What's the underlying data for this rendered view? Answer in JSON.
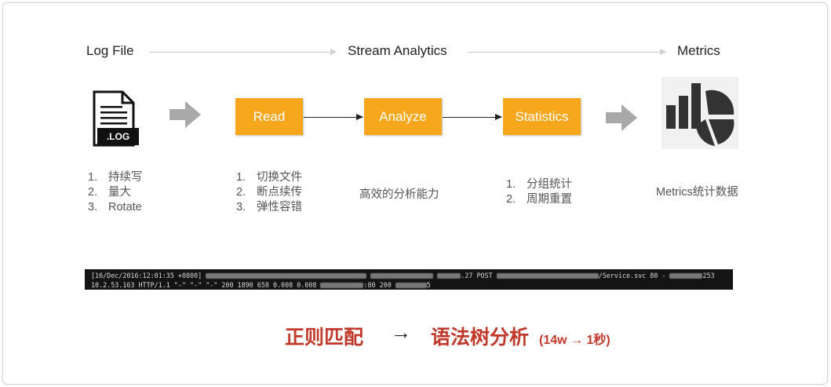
{
  "stages": {
    "log_file": "Log File",
    "stream_analytics": "Stream Analytics",
    "metrics": "Metrics"
  },
  "icons": {
    "log": ".LOG"
  },
  "boxes": {
    "read": "Read",
    "analyze": "Analyze",
    "statistics": "Statistics"
  },
  "colors": {
    "box": "#f7a71c",
    "grey_arrow": "#a9a9a9",
    "emphasis": "#c0392b"
  },
  "lists": {
    "log_file": [
      {
        "num": "1.",
        "text": "持续写"
      },
      {
        "num": "2.",
        "text": "量大"
      },
      {
        "num": "3.",
        "text": "Rotate"
      }
    ],
    "read": [
      {
        "num": "1.",
        "text": "切换文件"
      },
      {
        "num": "2.",
        "text": "断点续传"
      },
      {
        "num": "3.",
        "text": "弹性容错"
      }
    ],
    "statistics": [
      {
        "num": "1.",
        "text": "分组统计"
      },
      {
        "num": "2.",
        "text": "周期重置"
      }
    ]
  },
  "notes": {
    "analyze": "高效的分析能力",
    "metrics": "Metrics统计数据"
  },
  "log_sample": {
    "line1_a": "[16/Dec/2016:12:01:35 +0800]",
    "line1_b": ".27 POST",
    "line1_c": "/Service.svc 80 -",
    "line1_d": "253",
    "line2_a": "10.2.53.163 HTTP/1.1 \"-\" \"-\" \"-\" 200 1890 658 0.008 0.008",
    "line2_b": ":80 200",
    "line2_c": "5"
  },
  "bottom": {
    "regex": "正则匹配",
    "arrow": "→",
    "syntax_tree": "语法树分析",
    "perf": "(14w → 1秒)"
  }
}
